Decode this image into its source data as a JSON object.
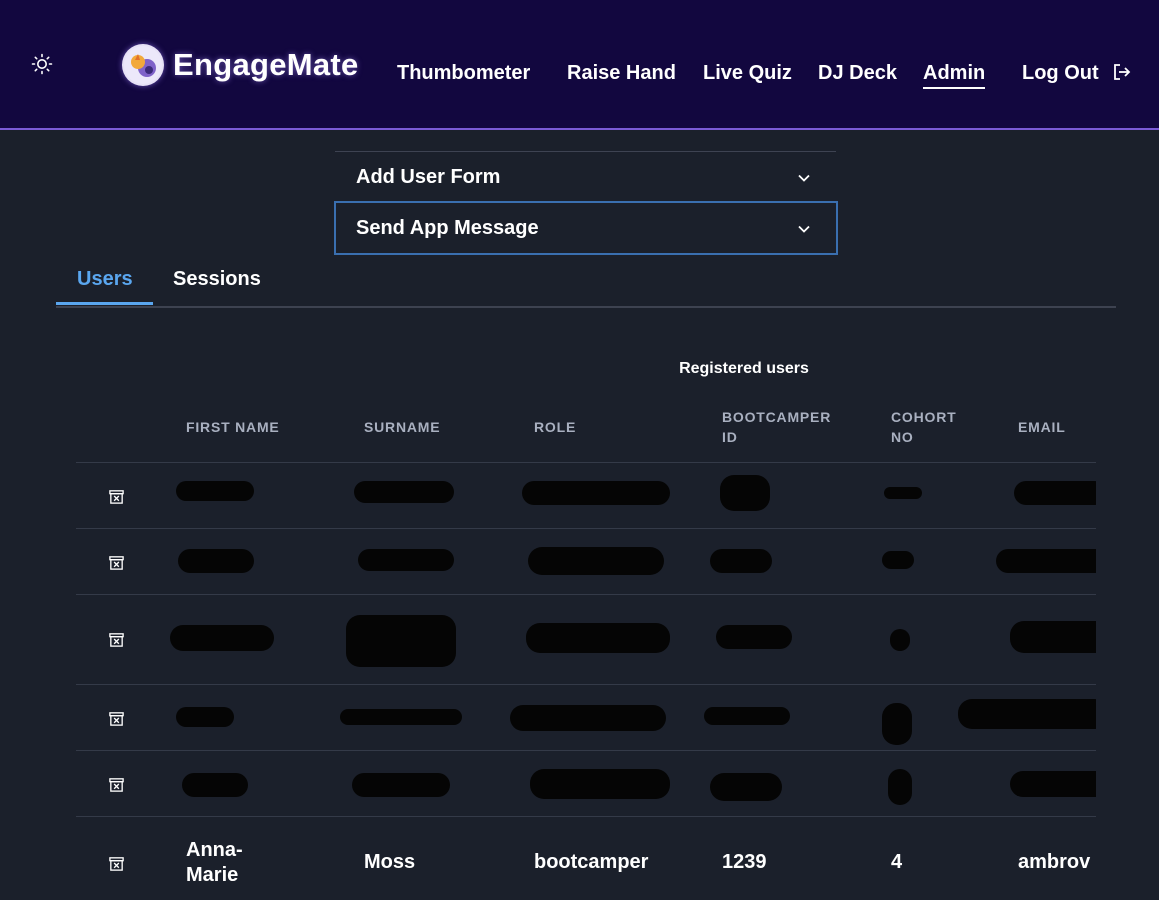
{
  "header": {
    "theme_toggle": "sun-icon",
    "brand": "EngageMate",
    "nav": [
      "Thumbometer",
      "Raise Hand",
      "Live Quiz",
      "DJ Deck",
      "Admin"
    ],
    "active_nav": "Admin",
    "logout": "Log Out"
  },
  "accordions": [
    "Add User Form",
    "Send App Message"
  ],
  "tabs": {
    "users": "Users",
    "sessions": "Sessions"
  },
  "table": {
    "caption": "Registered users",
    "headers": {
      "first_name": "FIRST NAME",
      "surname": "SURNAME",
      "role": "ROLE",
      "bootcamper_id_1": "BOOTCAMPER",
      "bootcamper_id_2": "ID",
      "cohort_no_1": "COHORT",
      "cohort_no_2": "NO",
      "email": "EMAIL"
    },
    "visible_row": {
      "first_name_1": "Anna-",
      "first_name_2": "Marie",
      "surname": "Moss",
      "role": "bootcamper",
      "bootcamper_id": "1239",
      "cohort_no": "4",
      "email": "ambrov"
    }
  },
  "colors": {
    "header_bg": "#12073f",
    "header_border": "#7b5bd6",
    "page_bg": "#1b202b",
    "accent": "#5aa6ef",
    "focus_border": "#3a6fb0"
  }
}
